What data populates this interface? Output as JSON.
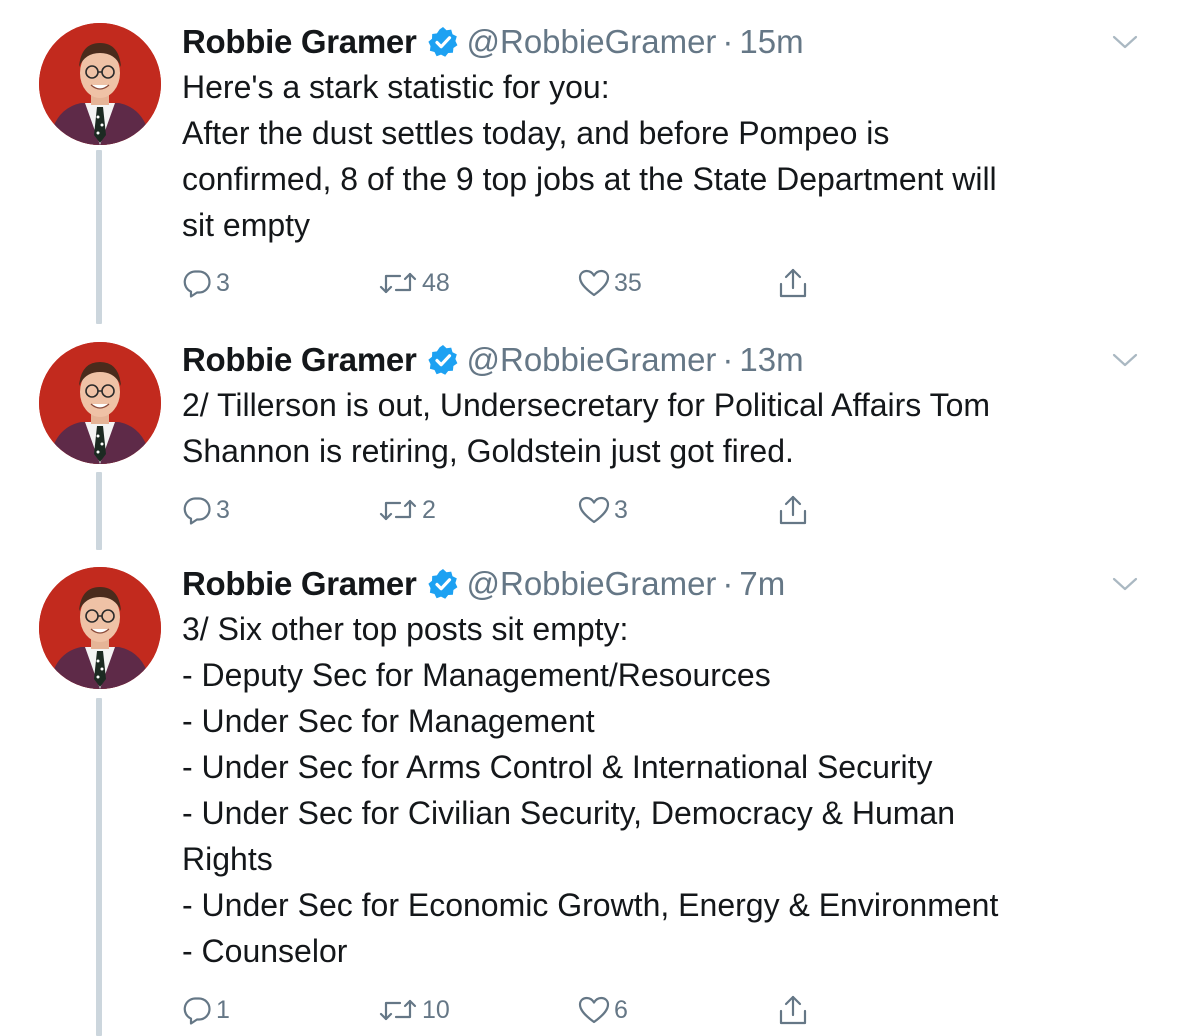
{
  "tweets": [
    {
      "name": "Robbie Gramer",
      "handle": "@RobbieGramer",
      "separator": "·",
      "time": "15m",
      "lines": [
        "Here's a stark statistic for you:",
        "After the dust settles today, and before Pompeo is",
        "confirmed, 8 of the 9 top jobs at the State Department will",
        "sit empty"
      ],
      "replies": "3",
      "retweets": "48",
      "likes": "35"
    },
    {
      "name": "Robbie Gramer",
      "handle": "@RobbieGramer",
      "separator": "·",
      "time": "13m",
      "lines": [
        "2/ Tillerson is out, Undersecretary for Political Affairs Tom",
        "Shannon is retiring, Goldstein just got fired."
      ],
      "replies": "3",
      "retweets": "2",
      "likes": "3"
    },
    {
      "name": "Robbie Gramer",
      "handle": "@RobbieGramer",
      "separator": "·",
      "time": "7m",
      "lines": [
        "3/ Six other top posts sit empty:",
        "- Deputy Sec for Management/Resources",
        "- Under Sec for Management",
        "- Under Sec for Arms Control & International Security",
        "- Under Sec for Civilian Security, Democracy & Human",
        "Rights",
        "- Under Sec for Economic Growth, Energy & Environment",
        "- Counselor"
      ],
      "replies": "1",
      "retweets": "10",
      "likes": "6"
    }
  ],
  "icons": {
    "verified": "verified-badge-icon",
    "more": "chevron-down-icon",
    "reply": "reply-icon",
    "retweet": "retweet-icon",
    "like": "heart-icon",
    "share": "share-icon"
  },
  "colors": {
    "text": "#14171a",
    "secondary": "#657786",
    "verified": "#1da1f2",
    "thread_line": "#ccd6dd",
    "avatar_bg": "#c22a1e"
  }
}
